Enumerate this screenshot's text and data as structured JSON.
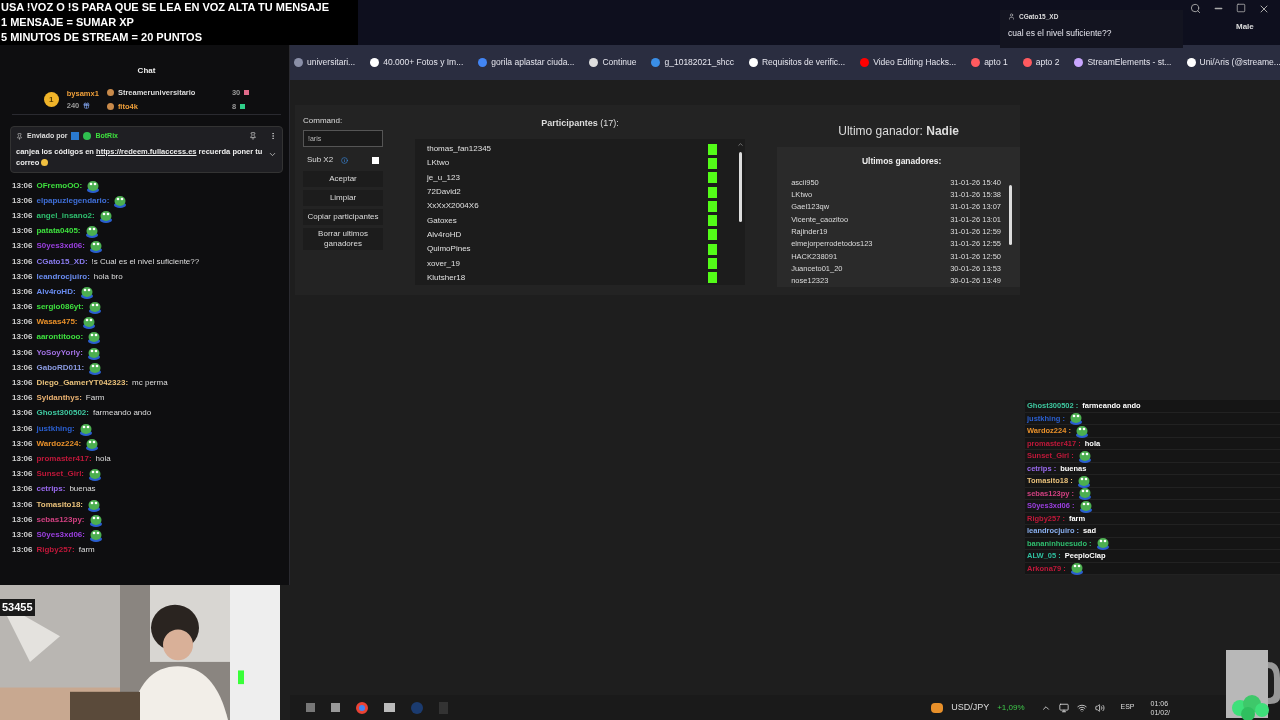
{
  "overlay_text": [
    "USA !VOZ O !S PARA QUE SE LEA EN VOZ ALTA TU MENSAJE",
    "1 MENSAJE = SUMAR XP",
    "5 MINUTOS DE STREAM = 20 PUNTOS"
  ],
  "notification": {
    "user": "CGato15_XD",
    "message": "cual es el nivel suficiente??",
    "label": "Male"
  },
  "bookmarks": [
    {
      "label": "universitari...",
      "color": "#8a8fa8"
    },
    {
      "label": "40.000+ Fotos y Im...",
      "color": "#ffffff"
    },
    {
      "label": "gorila aplastar ciuda...",
      "color": "#4285f4"
    },
    {
      "label": "Continue",
      "color": "#dddddd"
    },
    {
      "label": "g_10182021_shcc",
      "color": "#3a8ee6"
    },
    {
      "label": "Requisitos de verific...",
      "color": "#ffffff"
    },
    {
      "label": "Video Editing Hacks...",
      "color": "#ff0000"
    },
    {
      "label": "apto 1",
      "color": "#ff5a5f"
    },
    {
      "label": "apto 2",
      "color": "#ff5a5f"
    },
    {
      "label": "StreamElements - st...",
      "color": "#c9a6ff"
    },
    {
      "label": "Uni/Aris (@streame...",
      "color": "#ffffff"
    }
  ],
  "chat": {
    "title": "Chat",
    "leaderboard": {
      "rank": "1",
      "top_user": "bysamx1",
      "top_points": "240",
      "others": [
        {
          "name": "Streameruniversitario",
          "points": "30",
          "color": "#e06a8a"
        },
        {
          "name": "fito4k",
          "points": "8",
          "color": "#2fd08a"
        }
      ]
    },
    "pinned": {
      "sent_by": "Enviado por",
      "bot": "BotRix",
      "text_before": "canjea los códigos en",
      "link": "https://redeem.fullaccess.es",
      "text_after": "recuerda poner tu correo"
    },
    "messages": [
      {
        "time": "13:06",
        "user": "OFremoOO:",
        "color": "#3ee03e",
        "emote": true
      },
      {
        "time": "13:06",
        "user": "elpapuzlegendario:",
        "color": "#3f6fd8",
        "emote": true
      },
      {
        "time": "13:06",
        "user": "angel_insano2:",
        "color": "#2fbf6f",
        "emote": true
      },
      {
        "time": "13:06",
        "user": "patata0405:",
        "color": "#3ee03e",
        "emote": true
      },
      {
        "time": "13:06",
        "user": "S0yes3xd06:",
        "color": "#9b3fe0",
        "emote": true
      },
      {
        "time": "13:06",
        "user": "CGato15_XD:",
        "color": "#8a7cf0",
        "text": "!s Cual es el nivel suficiente??",
        "emote": false
      },
      {
        "time": "13:06",
        "user": "leandrocjuiro:",
        "color": "#6a8cf0",
        "text": "hola bro",
        "emote": false
      },
      {
        "time": "13:06",
        "user": "Alv4roHD:",
        "color": "#6a8cf0",
        "emote": true
      },
      {
        "time": "13:06",
        "user": "sergio086yt:",
        "color": "#3ee03e",
        "emote": true
      },
      {
        "time": "13:06",
        "user": "Wasas475:",
        "color": "#e8902a",
        "emote": true
      },
      {
        "time": "13:06",
        "user": "aarontitooo:",
        "color": "#3ee03e",
        "emote": true
      },
      {
        "time": "13:06",
        "user": "YoSoyYorly:",
        "color": "#a070e0",
        "emote": true
      },
      {
        "time": "13:06",
        "user": "GaboRD011:",
        "color": "#8a9ae0",
        "emote": true
      },
      {
        "time": "13:06",
        "user": "Diego_GamerYT042323:",
        "color": "#e8c07a",
        "text": "mc perma",
        "emote": false
      },
      {
        "time": "13:06",
        "user": "Syldanthys:",
        "color": "#e8b070",
        "text": "Farm",
        "emote": false
      },
      {
        "time": "13:06",
        "user": "Ghost300502:",
        "color": "#3ec8a0",
        "text": "farmeando ando",
        "emote": false
      },
      {
        "time": "13:06",
        "user": "justkhing:",
        "color": "#2a5fd0",
        "emote": true
      },
      {
        "time": "13:06",
        "user": "Wardoz224:",
        "color": "#e8902a",
        "emote": true
      },
      {
        "time": "13:06",
        "user": "promaster417:",
        "color": "#c0183a",
        "text": "hola",
        "emote": false
      },
      {
        "time": "13:06",
        "user": "Sunset_Girl:",
        "color": "#c0183a",
        "emote": true
      },
      {
        "time": "13:06",
        "user": "cetrips:",
        "color": "#9a6af0",
        "text": "buenas",
        "emote": false
      },
      {
        "time": "13:06",
        "user": "Tomasito18:",
        "color": "#e8c07a",
        "emote": true
      },
      {
        "time": "13:06",
        "user": "sebas123py:",
        "color": "#d04080",
        "emote": true
      },
      {
        "time": "13:06",
        "user": "S0yes3xd06:",
        "color": "#9b3fe0",
        "emote": true
      },
      {
        "time": "13:06",
        "user": "Rigby257:",
        "color": "#c0183a",
        "text": "farm",
        "emote": false
      }
    ]
  },
  "viewer_count": "53455",
  "giveaway": {
    "command_label": "Command:",
    "command_value": "!aris",
    "sub_label": "Sub X2",
    "sub_checked": false,
    "buttons": [
      "Aceptar",
      "Limpiar",
      "Copiar participantes",
      "Borrar ultimos ganadores"
    ],
    "participants_title": "**Participantes** (17):",
    "participants": [
      "thomas_fan12345",
      "LKtwo",
      "je_u_123",
      "72David2",
      "XxXxX2004X6",
      "Gatoxes",
      "Alv4roHD",
      "QuimoPines",
      "xover_19",
      "Klutsher18"
    ],
    "last_winner": "Ultimo ganador: **Nadie**",
    "winners_title": "Ultimos ganadores:",
    "winners": [
      {
        "name": "ascii950",
        "date": "31-01-26 15:40"
      },
      {
        "name": "LKtwo",
        "date": "31-01-26 15:38"
      },
      {
        "name": "Gael123qw",
        "date": "31-01-26 13:07"
      },
      {
        "name": "Vicente_caozitoo",
        "date": "31-01-26 13:01"
      },
      {
        "name": "Rajinder19",
        "date": "31-01-26 12:59"
      },
      {
        "name": "elmejorperrodetodos123",
        "date": "31-01-26 12:55"
      },
      {
        "name": "HACK238091",
        "date": "31-01-26 12:50"
      },
      {
        "name": "Juanceto01_20",
        "date": "30-01-26 13:53"
      },
      {
        "name": "nose12323",
        "date": "30-01-26 13:49"
      }
    ]
  },
  "overlay_chat": [
    {
      "user": "Ghost300502 :",
      "color": "#3ec8a0",
      "text": "farmeando ando",
      "emote": false
    },
    {
      "user": "justkhing :",
      "color": "#2a5fd0",
      "emote": true
    },
    {
      "user": "Wardoz224 :",
      "color": "#e8902a",
      "emote": true
    },
    {
      "user": "promaster417 :",
      "color": "#c0183a",
      "text": "hola",
      "emote": false
    },
    {
      "user": "Sunset_Girl :",
      "color": "#c0183a",
      "emote": true
    },
    {
      "user": "cetrips :",
      "color": "#9a6af0",
      "text": "buenas",
      "emote": false
    },
    {
      "user": "Tomasito18 :",
      "color": "#e8c07a",
      "emote": true
    },
    {
      "user": "sebas123py :",
      "color": "#d04080",
      "emote": true
    },
    {
      "user": "S0yes3xd06 :",
      "color": "#9b3fe0",
      "emote": true
    },
    {
      "user": "Rigby257 :",
      "color": "#c0183a",
      "text": "farm",
      "emote": false
    },
    {
      "user": "leandrocjuiro :",
      "color": "#8ab0f0",
      "text": "sad",
      "emote": false
    },
    {
      "user": "bananinhuesudo :",
      "color": "#2fbf6f",
      "emote": true
    },
    {
      "user": "ALW_05 :",
      "color": "#2fbf9f",
      "text": "PeeploClap",
      "emote": false
    },
    {
      "user": "Arkona79 :",
      "color": "#c0183a",
      "emote": true
    }
  ],
  "taskbar": {
    "ticker": "USD/JPY",
    "change": "+1,09%",
    "language": "ESP",
    "time": "01:06",
    "date": "01/02/"
  }
}
